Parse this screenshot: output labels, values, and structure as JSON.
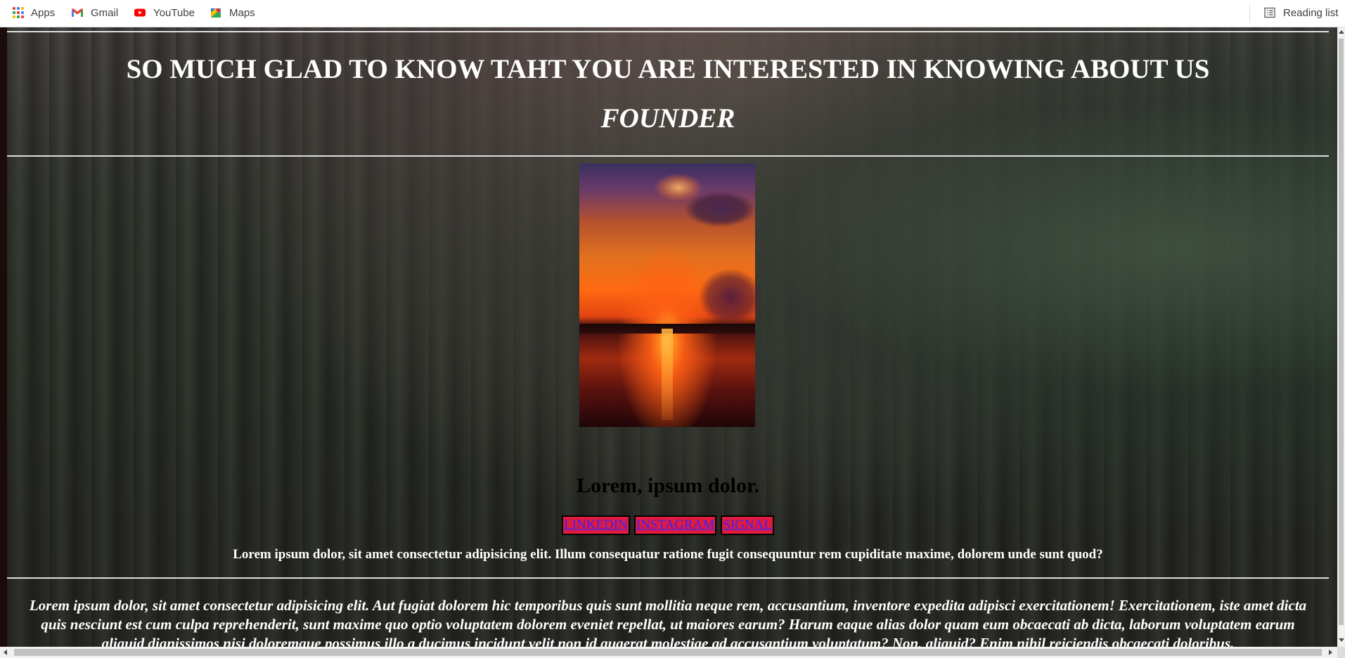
{
  "bookmarks": {
    "items": [
      {
        "label": "Apps",
        "icon": "apps-grid-icon"
      },
      {
        "label": "Gmail",
        "icon": "gmail-icon"
      },
      {
        "label": "YouTube",
        "icon": "youtube-icon"
      },
      {
        "label": "Maps",
        "icon": "maps-icon"
      }
    ],
    "reading_list": {
      "label": "Reading list",
      "icon": "reading-list-icon"
    }
  },
  "page": {
    "headline": "SO MUCH GLAD TO KNOW TAHT YOU ARE INTERESTED IN KNOWING ABOUT US",
    "section_title": "FOUNDER",
    "founder_name": "Lorem, ipsum dolor.",
    "social_links": [
      "LINKEDIN",
      "INSTAGRAM",
      "SIGNAL"
    ],
    "bio": "Lorem ipsum dolor, sit amet consectetur adipisicing elit. Illum consequatur ratione fugit consequuntur rem cupiditate maxime, dolorem unde sunt quod?",
    "description": "Lorem ipsum dolor, sit amet consectetur adipisicing elit. Aut fugiat dolorem hic temporibus quis sunt mollitia neque rem, accusantium, inventore expedita adipisci exercitationem! Exercitationem, iste amet dicta quis nesciunt est cum culpa reprehenderit, sunt maxime quo optio voluptatem dolorem eveniet repellat, ut maiores earum? Harum eaque alias dolor quam eum obcaecati ab dicta, laborum voluptatem earum aliquid dignissimos nisi doloremque possimus illo a ducimus incidunt velit non id quaerat molestiae ad accusantium voluptatum? Non, aliquid? Enim nihil reiciendis obcaecati doloribus."
  },
  "colors": {
    "social_bg": "#e01b3c",
    "social_text": "#3b20ff",
    "heading_text": "#ffffff"
  }
}
